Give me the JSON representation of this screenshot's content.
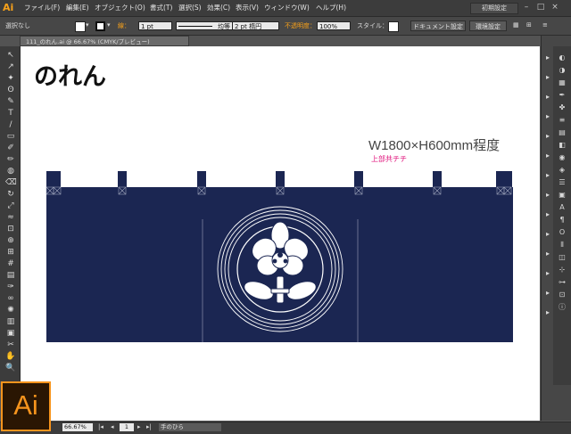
{
  "app": {
    "name": "Illustrator",
    "logo_text": "Ai"
  },
  "menubar": {
    "items": [
      "ファイル(F)",
      "編集(E)",
      "オブジェクト(O)",
      "書式(T)",
      "選択(S)",
      "効果(C)",
      "表示(V)",
      "ウィンドウ(W)",
      "ヘルプ(H)"
    ],
    "workspace": "初期設定",
    "window_buttons": [
      "–",
      "□",
      "×"
    ]
  },
  "control_bar": {
    "selection": "選択なし",
    "stroke_label": "線：",
    "stroke_weight": "1 pt",
    "stroke_style": "均等",
    "brush": "2 pt 楕円",
    "opacity_label": "不透明度：",
    "opacity": "100%",
    "style_label": "スタイル：",
    "doc_setup": "ドキュメント設定",
    "preferences": "環境設定",
    "colors": {
      "accent": "#f7a11a"
    }
  },
  "document_tab": {
    "label": "111_のれん.ai @ 66.67% (CMYK/プレビュー)"
  },
  "tools": [
    "selection-tool",
    "direct-selection-tool",
    "magic-wand-tool",
    "lasso-tool",
    "pen-tool",
    "type-tool",
    "line-tool",
    "rectangle-tool",
    "brush-tool",
    "pencil-tool",
    "blob-brush-tool",
    "eraser-tool",
    "rotate-tool",
    "scale-tool",
    "width-tool",
    "free-transform-tool",
    "shape-builder-tool",
    "perspective-tool",
    "mesh-tool",
    "gradient-tool",
    "eyedropper-tool",
    "blend-tool",
    "symbol-tool",
    "graph-tool",
    "artboard-tool",
    "slice-tool",
    "hand-tool",
    "zoom-tool"
  ],
  "artboard": {
    "title": "のれん",
    "size_label": "W1800×H600mm程度",
    "chichi_label": "上部共チチ",
    "colors": {
      "noren": "#1b2652",
      "white": "#ffffff",
      "label_pink": "#e0137c",
      "tab_outline": "#9aa0b8"
    }
  },
  "statusbar": {
    "zoom": "66.67%",
    "page": "1",
    "tool_name": "手のひら"
  }
}
